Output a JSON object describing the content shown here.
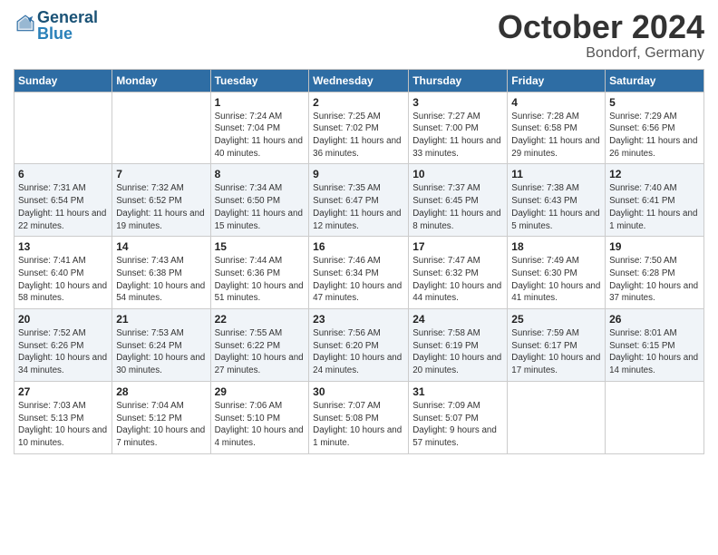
{
  "header": {
    "logo_line1": "General",
    "logo_line2": "Blue",
    "month_title": "October 2024",
    "location": "Bondorf, Germany"
  },
  "weekdays": [
    "Sunday",
    "Monday",
    "Tuesday",
    "Wednesday",
    "Thursday",
    "Friday",
    "Saturday"
  ],
  "weeks": [
    [
      {
        "day": "",
        "info": ""
      },
      {
        "day": "",
        "info": ""
      },
      {
        "day": "1",
        "info": "Sunrise: 7:24 AM\nSunset: 7:04 PM\nDaylight: 11 hours and 40 minutes."
      },
      {
        "day": "2",
        "info": "Sunrise: 7:25 AM\nSunset: 7:02 PM\nDaylight: 11 hours and 36 minutes."
      },
      {
        "day": "3",
        "info": "Sunrise: 7:27 AM\nSunset: 7:00 PM\nDaylight: 11 hours and 33 minutes."
      },
      {
        "day": "4",
        "info": "Sunrise: 7:28 AM\nSunset: 6:58 PM\nDaylight: 11 hours and 29 minutes."
      },
      {
        "day": "5",
        "info": "Sunrise: 7:29 AM\nSunset: 6:56 PM\nDaylight: 11 hours and 26 minutes."
      }
    ],
    [
      {
        "day": "6",
        "info": "Sunrise: 7:31 AM\nSunset: 6:54 PM\nDaylight: 11 hours and 22 minutes."
      },
      {
        "day": "7",
        "info": "Sunrise: 7:32 AM\nSunset: 6:52 PM\nDaylight: 11 hours and 19 minutes."
      },
      {
        "day": "8",
        "info": "Sunrise: 7:34 AM\nSunset: 6:50 PM\nDaylight: 11 hours and 15 minutes."
      },
      {
        "day": "9",
        "info": "Sunrise: 7:35 AM\nSunset: 6:47 PM\nDaylight: 11 hours and 12 minutes."
      },
      {
        "day": "10",
        "info": "Sunrise: 7:37 AM\nSunset: 6:45 PM\nDaylight: 11 hours and 8 minutes."
      },
      {
        "day": "11",
        "info": "Sunrise: 7:38 AM\nSunset: 6:43 PM\nDaylight: 11 hours and 5 minutes."
      },
      {
        "day": "12",
        "info": "Sunrise: 7:40 AM\nSunset: 6:41 PM\nDaylight: 11 hours and 1 minute."
      }
    ],
    [
      {
        "day": "13",
        "info": "Sunrise: 7:41 AM\nSunset: 6:40 PM\nDaylight: 10 hours and 58 minutes."
      },
      {
        "day": "14",
        "info": "Sunrise: 7:43 AM\nSunset: 6:38 PM\nDaylight: 10 hours and 54 minutes."
      },
      {
        "day": "15",
        "info": "Sunrise: 7:44 AM\nSunset: 6:36 PM\nDaylight: 10 hours and 51 minutes."
      },
      {
        "day": "16",
        "info": "Sunrise: 7:46 AM\nSunset: 6:34 PM\nDaylight: 10 hours and 47 minutes."
      },
      {
        "day": "17",
        "info": "Sunrise: 7:47 AM\nSunset: 6:32 PM\nDaylight: 10 hours and 44 minutes."
      },
      {
        "day": "18",
        "info": "Sunrise: 7:49 AM\nSunset: 6:30 PM\nDaylight: 10 hours and 41 minutes."
      },
      {
        "day": "19",
        "info": "Sunrise: 7:50 AM\nSunset: 6:28 PM\nDaylight: 10 hours and 37 minutes."
      }
    ],
    [
      {
        "day": "20",
        "info": "Sunrise: 7:52 AM\nSunset: 6:26 PM\nDaylight: 10 hours and 34 minutes."
      },
      {
        "day": "21",
        "info": "Sunrise: 7:53 AM\nSunset: 6:24 PM\nDaylight: 10 hours and 30 minutes."
      },
      {
        "day": "22",
        "info": "Sunrise: 7:55 AM\nSunset: 6:22 PM\nDaylight: 10 hours and 27 minutes."
      },
      {
        "day": "23",
        "info": "Sunrise: 7:56 AM\nSunset: 6:20 PM\nDaylight: 10 hours and 24 minutes."
      },
      {
        "day": "24",
        "info": "Sunrise: 7:58 AM\nSunset: 6:19 PM\nDaylight: 10 hours and 20 minutes."
      },
      {
        "day": "25",
        "info": "Sunrise: 7:59 AM\nSunset: 6:17 PM\nDaylight: 10 hours and 17 minutes."
      },
      {
        "day": "26",
        "info": "Sunrise: 8:01 AM\nSunset: 6:15 PM\nDaylight: 10 hours and 14 minutes."
      }
    ],
    [
      {
        "day": "27",
        "info": "Sunrise: 7:03 AM\nSunset: 5:13 PM\nDaylight: 10 hours and 10 minutes."
      },
      {
        "day": "28",
        "info": "Sunrise: 7:04 AM\nSunset: 5:12 PM\nDaylight: 10 hours and 7 minutes."
      },
      {
        "day": "29",
        "info": "Sunrise: 7:06 AM\nSunset: 5:10 PM\nDaylight: 10 hours and 4 minutes."
      },
      {
        "day": "30",
        "info": "Sunrise: 7:07 AM\nSunset: 5:08 PM\nDaylight: 10 hours and 1 minute."
      },
      {
        "day": "31",
        "info": "Sunrise: 7:09 AM\nSunset: 5:07 PM\nDaylight: 9 hours and 57 minutes."
      },
      {
        "day": "",
        "info": ""
      },
      {
        "day": "",
        "info": ""
      }
    ]
  ]
}
